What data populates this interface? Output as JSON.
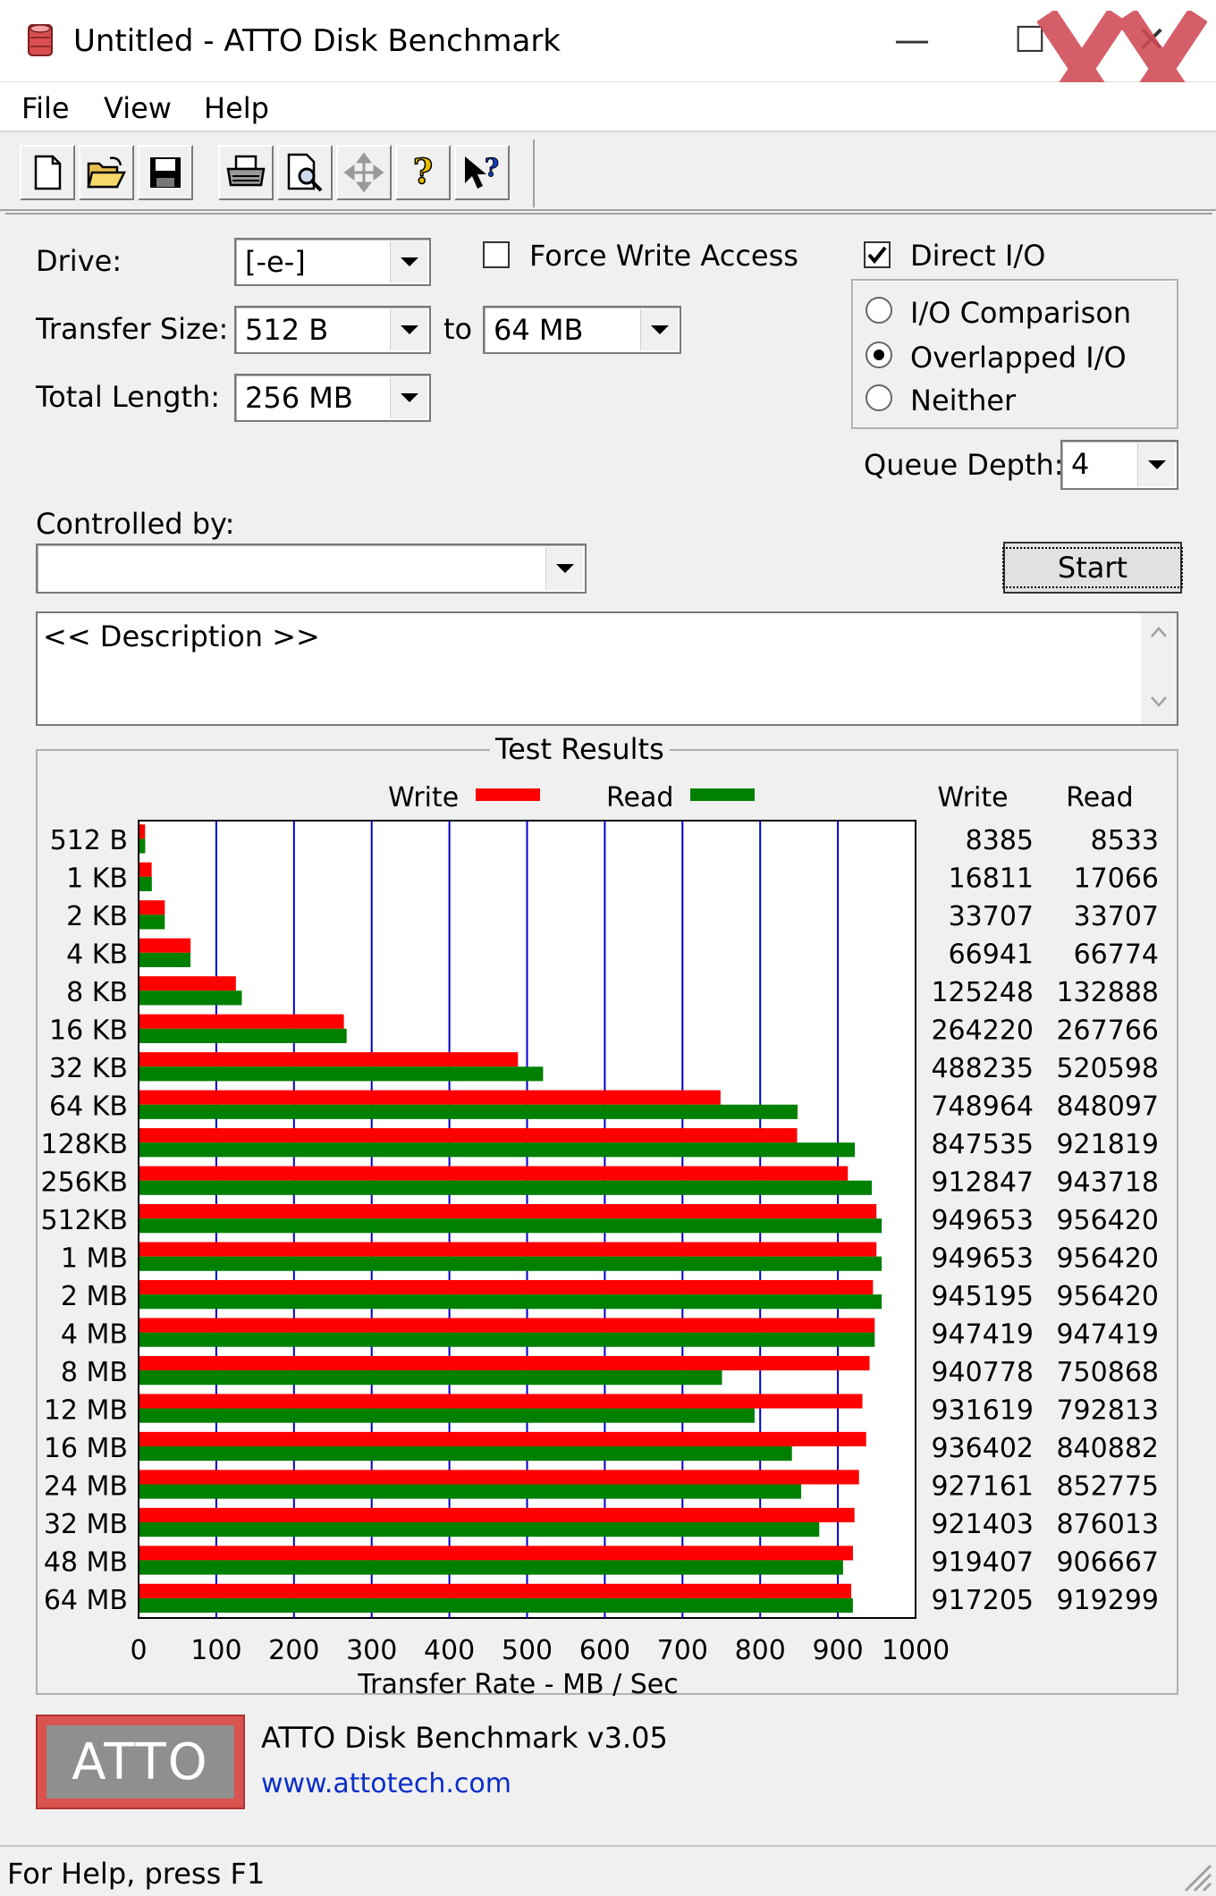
{
  "window": {
    "title": "Untitled - ATTO Disk Benchmark",
    "minimize_glyph": "—",
    "maximize_glyph": "☐",
    "close_glyph": "✕"
  },
  "menu": [
    "File",
    "View",
    "Help"
  ],
  "toolbar": {
    "buttons": [
      "new-document-icon",
      "open-folder-icon",
      "save-disk-icon",
      "print-icon",
      "print-preview-icon",
      "move-arrows-icon",
      "help-question-icon",
      "context-help-pointer-icon"
    ]
  },
  "settings": {
    "drive_label": "Drive:",
    "drive_value": "[-e-]",
    "transfer_size_label": "Transfer Size:",
    "transfer_from": "512 B",
    "transfer_to_label": "to",
    "transfer_to": "64 MB",
    "total_length_label": "Total Length:",
    "total_length": "256 MB",
    "force_write_label": "Force Write Access",
    "force_write_checked": false,
    "direct_io_label": "Direct I/O",
    "direct_io_checked": true,
    "io_options": [
      {
        "label": "I/O Comparison",
        "selected": false
      },
      {
        "label": "Overlapped I/O",
        "selected": true
      },
      {
        "label": "Neither",
        "selected": false
      }
    ],
    "queue_depth_label": "Queue Depth:",
    "queue_depth": "4",
    "controlled_by_label": "Controlled by:",
    "controlled_by_value": "",
    "start_label": "Start",
    "description": "<< Description >>"
  },
  "results": {
    "title": "Test Results",
    "write_col": "Write",
    "read_col": "Read"
  },
  "chart_data": {
    "type": "bar",
    "orientation": "horizontal",
    "title": "Test Results",
    "xlabel": "Transfer Rate - MB / Sec",
    "xlim": [
      0,
      1000
    ],
    "xticks": [
      "0",
      "100",
      "200",
      "300",
      "400",
      "500",
      "600",
      "700",
      "800",
      "900",
      "1000"
    ],
    "grid": true,
    "legend": "top",
    "categories": [
      "512 B",
      "1 KB",
      "2 KB",
      "4 KB",
      "8 KB",
      "16 KB",
      "32 KB",
      "64 KB",
      "128KB",
      "256KB",
      "512KB",
      "1 MB",
      "2 MB",
      "4 MB",
      "8 MB",
      "12 MB",
      "16 MB",
      "24 MB",
      "32 MB",
      "48 MB",
      "64 MB"
    ],
    "series": [
      {
        "name": "Write",
        "color": "#ff0000",
        "values": [
          8.385,
          16.811,
          33.707,
          66.941,
          125.248,
          264.22,
          488.235,
          748.964,
          847.535,
          912.847,
          949.653,
          949.653,
          945.195,
          947.419,
          940.778,
          931.619,
          936.402,
          927.161,
          921.403,
          919.407,
          917.205
        ],
        "labels": [
          "8385",
          "16811",
          "33707",
          "66941",
          "125248",
          "264220",
          "488235",
          "748964",
          "847535",
          "912847",
          "949653",
          "949653",
          "945195",
          "947419",
          "940778",
          "931619",
          "936402",
          "927161",
          "921403",
          "919407",
          "917205"
        ]
      },
      {
        "name": "Read",
        "color": "#008000",
        "values": [
          8.533,
          17.066,
          33.707,
          66.774,
          132.888,
          267.766,
          520.598,
          848.097,
          921.819,
          943.718,
          956.42,
          956.42,
          956.42,
          947.419,
          750.868,
          792.813,
          840.882,
          852.775,
          876.013,
          906.667,
          919.299
        ],
        "labels": [
          "8533",
          "17066",
          "33707",
          "66774",
          "132888",
          "267766",
          "520598",
          "848097",
          "921819",
          "943718",
          "956420",
          "956420",
          "956420",
          "947419",
          "750868",
          "792813",
          "840882",
          "852775",
          "876013",
          "906667",
          "919299"
        ]
      }
    ],
    "gridline_color": "#0000cc"
  },
  "footer": {
    "logo_text": "ATTO",
    "product": "ATTO Disk Benchmark v3.05",
    "url": "www.attotech.com"
  },
  "status": {
    "text": "For Help, press F1"
  },
  "watermark_text": "XX"
}
